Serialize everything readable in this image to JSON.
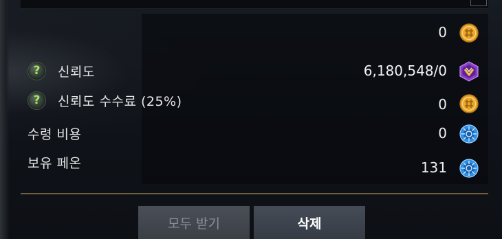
{
  "rows": [
    {
      "id": "top",
      "label": "",
      "value": "0",
      "icon": "gold-coin-icon"
    },
    {
      "id": "trust",
      "label": "신뢰도",
      "value": "6,180,548/0",
      "icon": "trust-badge-icon",
      "help": "?"
    },
    {
      "id": "trust_fee",
      "label": "신뢰도 수수료 (25%)",
      "value": "0",
      "icon": "gold-coin-icon",
      "help": "?"
    },
    {
      "id": "receive_cost",
      "label": "수령 비용",
      "value": "0",
      "icon": "blue-orb-icon"
    },
    {
      "id": "owned_pheon",
      "label": "보유 페온",
      "value": "131",
      "icon": "blue-orb-icon"
    }
  ],
  "buttons": {
    "receive_all": "모두 받기",
    "delete": "삭제"
  },
  "colors": {
    "gold": "#e8a526",
    "purple": "#8a3fc7",
    "blue": "#2f8fe6",
    "help_green": "#a8e55a",
    "divider": "#6e5d3f"
  }
}
